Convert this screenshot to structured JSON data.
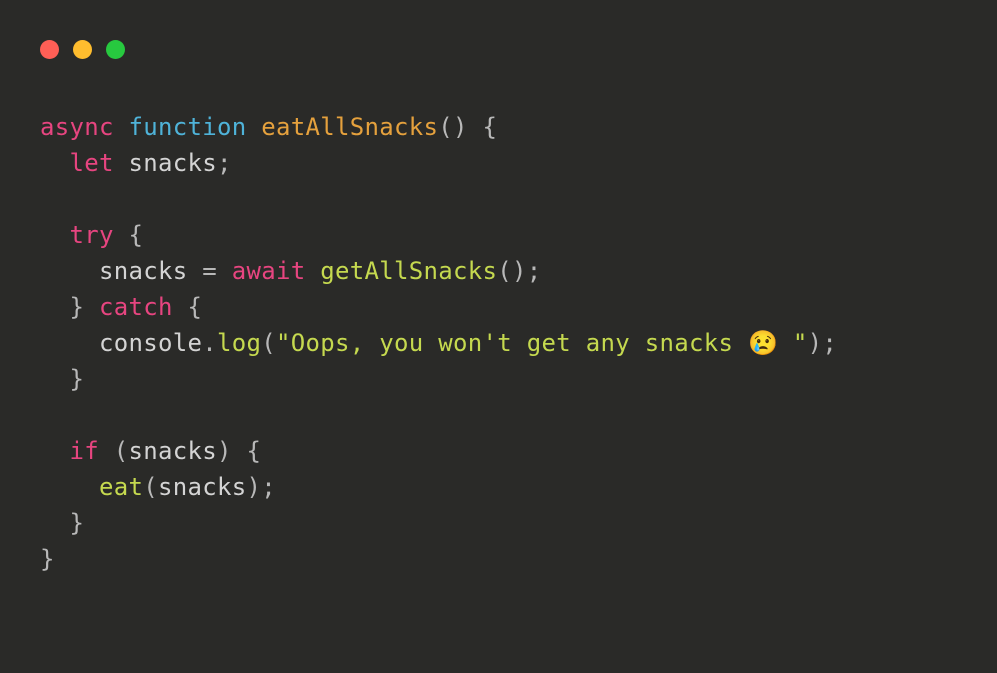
{
  "titlebar": {
    "buttons": {
      "close": "close",
      "minimize": "minimize",
      "maximize": "maximize"
    }
  },
  "code": {
    "lines": [
      {
        "tokens": [
          {
            "text": "async",
            "class": "tok-keyword"
          },
          {
            "text": " ",
            "class": "tok-punct"
          },
          {
            "text": "function",
            "class": "tok-declaration"
          },
          {
            "text": " ",
            "class": "tok-punct"
          },
          {
            "text": "eatAllSnacks",
            "class": "tok-function-name"
          },
          {
            "text": "(",
            "class": "tok-punct"
          },
          {
            "text": ")",
            "class": "tok-punct"
          },
          {
            "text": " ",
            "class": "tok-punct"
          },
          {
            "text": "{",
            "class": "tok-punct"
          }
        ]
      },
      {
        "tokens": [
          {
            "text": "  ",
            "class": "tok-punct"
          },
          {
            "text": "let",
            "class": "tok-keyword"
          },
          {
            "text": " ",
            "class": "tok-punct"
          },
          {
            "text": "snacks",
            "class": "tok-variable"
          },
          {
            "text": ";",
            "class": "tok-punct"
          }
        ]
      },
      {
        "tokens": [
          {
            "text": "",
            "class": "tok-punct"
          }
        ]
      },
      {
        "tokens": [
          {
            "text": "  ",
            "class": "tok-punct"
          },
          {
            "text": "try",
            "class": "tok-keyword"
          },
          {
            "text": " ",
            "class": "tok-punct"
          },
          {
            "text": "{",
            "class": "tok-punct"
          }
        ]
      },
      {
        "tokens": [
          {
            "text": "    ",
            "class": "tok-punct"
          },
          {
            "text": "snacks",
            "class": "tok-variable"
          },
          {
            "text": " ",
            "class": "tok-punct"
          },
          {
            "text": "=",
            "class": "tok-operator"
          },
          {
            "text": " ",
            "class": "tok-punct"
          },
          {
            "text": "await",
            "class": "tok-await"
          },
          {
            "text": " ",
            "class": "tok-punct"
          },
          {
            "text": "getAllSnacks",
            "class": "tok-call"
          },
          {
            "text": "(",
            "class": "tok-punct"
          },
          {
            "text": ")",
            "class": "tok-punct"
          },
          {
            "text": ";",
            "class": "tok-punct"
          }
        ]
      },
      {
        "tokens": [
          {
            "text": "  ",
            "class": "tok-punct"
          },
          {
            "text": "}",
            "class": "tok-punct"
          },
          {
            "text": " ",
            "class": "tok-punct"
          },
          {
            "text": "catch",
            "class": "tok-keyword"
          },
          {
            "text": " ",
            "class": "tok-punct"
          },
          {
            "text": "{",
            "class": "tok-punct"
          }
        ]
      },
      {
        "tokens": [
          {
            "text": "    ",
            "class": "tok-punct"
          },
          {
            "text": "console",
            "class": "tok-property"
          },
          {
            "text": ".",
            "class": "tok-punct"
          },
          {
            "text": "log",
            "class": "tok-call"
          },
          {
            "text": "(",
            "class": "tok-punct"
          },
          {
            "text": "\"Oops, you won't get any snacks 😢 \"",
            "class": "tok-string"
          },
          {
            "text": ")",
            "class": "tok-punct"
          },
          {
            "text": ";",
            "class": "tok-punct"
          }
        ]
      },
      {
        "tokens": [
          {
            "text": "  ",
            "class": "tok-punct"
          },
          {
            "text": "}",
            "class": "tok-punct"
          }
        ]
      },
      {
        "tokens": [
          {
            "text": "",
            "class": "tok-punct"
          }
        ]
      },
      {
        "tokens": [
          {
            "text": "  ",
            "class": "tok-punct"
          },
          {
            "text": "if",
            "class": "tok-keyword"
          },
          {
            "text": " ",
            "class": "tok-punct"
          },
          {
            "text": "(",
            "class": "tok-punct"
          },
          {
            "text": "snacks",
            "class": "tok-variable"
          },
          {
            "text": ")",
            "class": "tok-punct"
          },
          {
            "text": " ",
            "class": "tok-punct"
          },
          {
            "text": "{",
            "class": "tok-punct"
          }
        ]
      },
      {
        "tokens": [
          {
            "text": "    ",
            "class": "tok-punct"
          },
          {
            "text": "eat",
            "class": "tok-call"
          },
          {
            "text": "(",
            "class": "tok-punct"
          },
          {
            "text": "snacks",
            "class": "tok-variable"
          },
          {
            "text": ")",
            "class": "tok-punct"
          },
          {
            "text": ";",
            "class": "tok-punct"
          }
        ]
      },
      {
        "tokens": [
          {
            "text": "  ",
            "class": "tok-punct"
          },
          {
            "text": "}",
            "class": "tok-punct"
          }
        ]
      },
      {
        "tokens": [
          {
            "text": "}",
            "class": "tok-punct"
          }
        ]
      }
    ]
  }
}
